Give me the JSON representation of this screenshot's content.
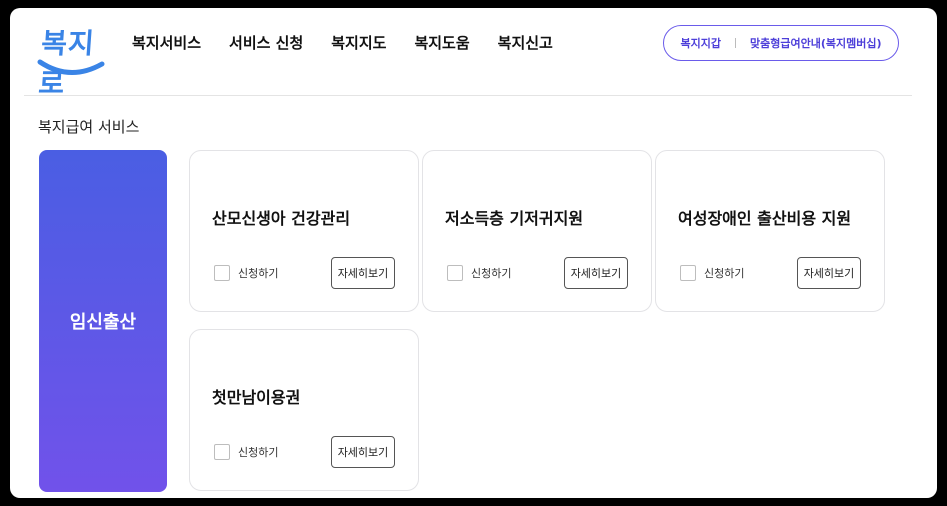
{
  "logo": {
    "text": "복지로"
  },
  "nav": [
    "복지서비스",
    "서비스 신청",
    "복지지도",
    "복지도움",
    "복지신고"
  ],
  "util": {
    "wallet": "복지지갑",
    "membership": "맞춤형급여안내(복지멤버십)"
  },
  "section": {
    "title": "복지급여 서비스"
  },
  "category": {
    "label": "임신출산"
  },
  "cards": [
    {
      "title": "산모신생아 건강관리",
      "apply_label": "신청하기",
      "detail_label": "자세히보기"
    },
    {
      "title": "저소득층 기저귀지원",
      "apply_label": "신청하기",
      "detail_label": "자세히보기"
    },
    {
      "title": "여성장애인 출산비용 지원",
      "apply_label": "신청하기",
      "detail_label": "자세히보기"
    },
    {
      "title": "첫만남이용권",
      "apply_label": "신청하기",
      "detail_label": "자세히보기"
    }
  ],
  "colors": {
    "accent": "#5b4fe8",
    "logo": "#3a84e6",
    "category_top": "#4a5ee3",
    "category_bottom": "#7152ea"
  }
}
